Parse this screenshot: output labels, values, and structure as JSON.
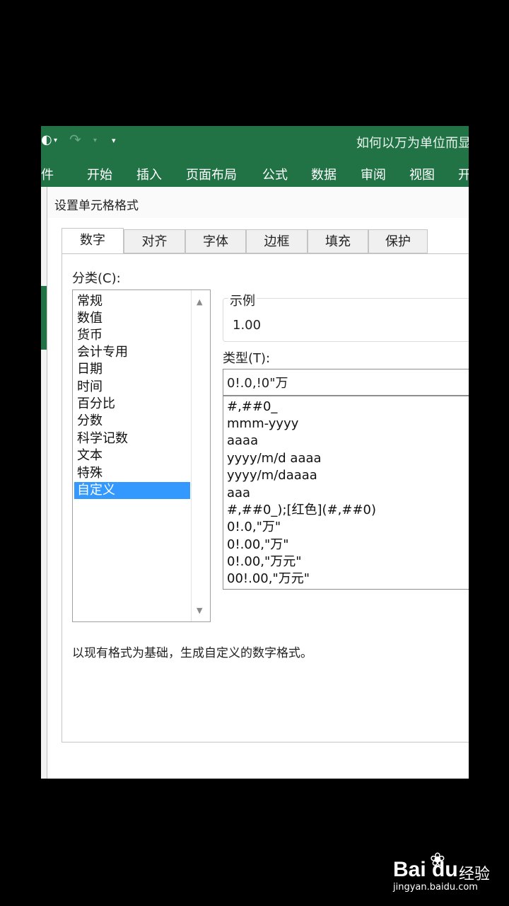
{
  "quick_access": {
    "save_glyph": "◐",
    "dropdown_glyph": "▾",
    "redo_glyph": "↷",
    "more_glyph": "▾"
  },
  "window": {
    "title": "如何以万为单位而显"
  },
  "ribbon": {
    "tabs": [
      "件",
      "开始",
      "插入",
      "页面布局",
      "公式",
      "数据",
      "审阅",
      "视图",
      "开"
    ]
  },
  "dialog": {
    "title": "设置单元格格式",
    "tabs": [
      "数字",
      "对齐",
      "字体",
      "边框",
      "填充",
      "保护"
    ],
    "category_label": "分类(C):",
    "categories": [
      "常规",
      "数值",
      "货币",
      "会计专用",
      "日期",
      "时间",
      "百分比",
      "分数",
      "科学记数",
      "文本",
      "特殊",
      "自定义"
    ],
    "selected_category": "自定义",
    "sample_label": "示例",
    "sample_value": "1.00",
    "type_label": "类型(T):",
    "type_value": "0!.0,!0\"万",
    "formats": [
      "#,##0_",
      "mmm-yyyy",
      "aaaa",
      "yyyy/m/d aaaa",
      "yyyy/m/daaaa",
      "aaa",
      "#,##0_);[红色](#,##0)",
      "0!.0,\"万\"",
      "0!.00,\"万\"",
      "0!.00,\"万元\"",
      "00!.00,\"万元\""
    ],
    "description": "以现有格式为基础，生成自定义的数字格式。",
    "scroll_up_glyph": "▲",
    "scroll_down_glyph": "▼"
  },
  "watermark": {
    "logo": "Bai du",
    "paw": "❀",
    "brand": "经验",
    "url": "jingyan.baidu.com"
  }
}
